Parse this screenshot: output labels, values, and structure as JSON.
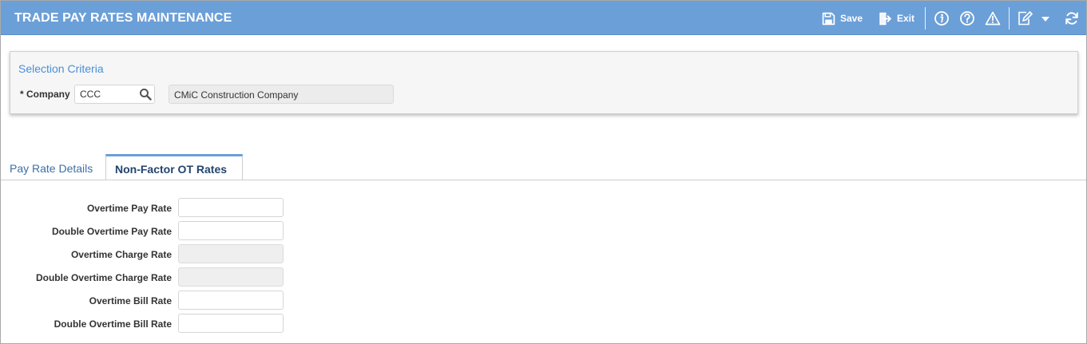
{
  "header": {
    "title": "TRADE PAY RATES MAINTENANCE",
    "save_label": "Save",
    "exit_label": "Exit",
    "icons": [
      "save-icon",
      "exit-icon",
      "info-icon",
      "help-icon",
      "warning-icon",
      "edit-icon",
      "chevron-down-icon",
      "refresh-icon"
    ]
  },
  "selection": {
    "title": "Selection Criteria",
    "company_label": "* Company",
    "company_value": "CCC",
    "company_name": "CMiC Construction Company"
  },
  "tabs": [
    {
      "label": "Pay Rate Details",
      "active": false
    },
    {
      "label": "Non-Factor OT Rates",
      "active": true
    }
  ],
  "form": {
    "fields": [
      {
        "label": "Overtime Pay Rate",
        "value": "",
        "readonly": false
      },
      {
        "label": "Double Overtime Pay Rate",
        "value": "",
        "readonly": false
      },
      {
        "label": "Overtime Charge Rate",
        "value": "",
        "readonly": true
      },
      {
        "label": "Double Overtime Charge Rate",
        "value": "",
        "readonly": true
      },
      {
        "label": "Overtime Bill Rate",
        "value": "",
        "readonly": false
      },
      {
        "label": "Double Overtime Bill Rate",
        "value": "",
        "readonly": false
      }
    ]
  },
  "colors": {
    "header_bg": "#6b9fd8",
    "section_title": "#4a8fd6",
    "tab_active_text": "#23446e",
    "tab_inactive_text": "#3c6fa8"
  }
}
